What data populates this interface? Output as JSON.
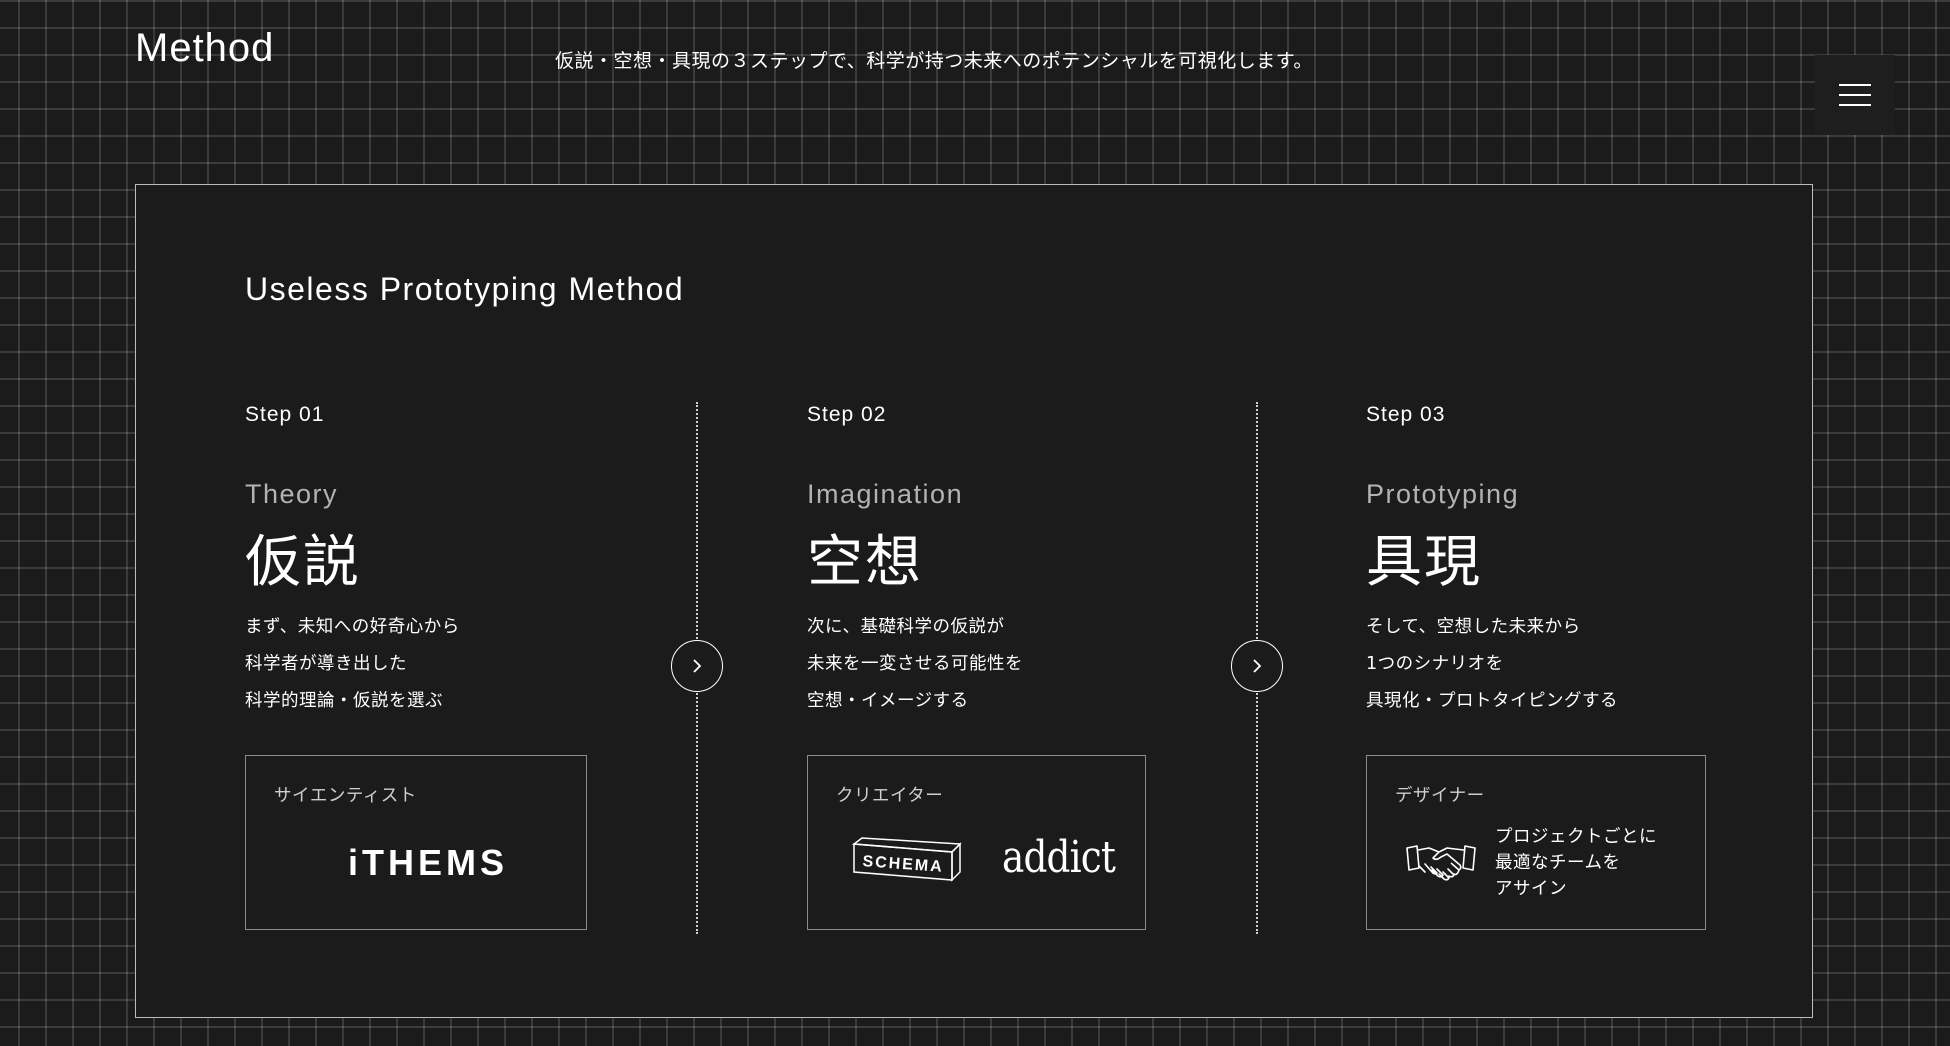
{
  "header": {
    "title": "Method",
    "tagline": "仮説・空想・具現の３ステップで、科学が持つ未来へのポテンシャルを可視化します。",
    "menu_icon": "hamburger-menu-icon"
  },
  "panel": {
    "title": "Useless Prototyping Method",
    "steps": [
      {
        "label": "Step 01",
        "english": "Theory",
        "japanese": "仮説",
        "description": [
          "まず、未知への好奇心から",
          "科学者が導き出した",
          "科学的理論・仮説を選ぶ"
        ],
        "card": {
          "label": "サイエンティスト",
          "logo_text": "iTHEMS"
        }
      },
      {
        "label": "Step 02",
        "english": "Imagination",
        "japanese": "空想",
        "description": [
          "次に、基礎科学の仮説が",
          "未来を一変させる可能性を",
          "空想・イメージする"
        ],
        "card": {
          "label": "クリエイター",
          "logos": [
            "SCHEMA",
            "addict"
          ]
        }
      },
      {
        "label": "Step 03",
        "english": "Prototyping",
        "japanese": "具現",
        "description": [
          "そして、空想した未来から",
          "1つのシナリオを",
          "具現化・プロトタイピングする"
        ],
        "card": {
          "label": "デザイナー",
          "icon": "handshake-icon",
          "text": [
            "プロジェクトごとに",
            "最適なチームを",
            "アサイン"
          ]
        }
      }
    ],
    "arrow_icon": "chevron-right-icon"
  },
  "colors": {
    "background": "#1b1b1b",
    "grid": "#3a3a3a",
    "text": "#ffffff",
    "muted": "#b3b3b3",
    "border": "#8a8a8a"
  }
}
